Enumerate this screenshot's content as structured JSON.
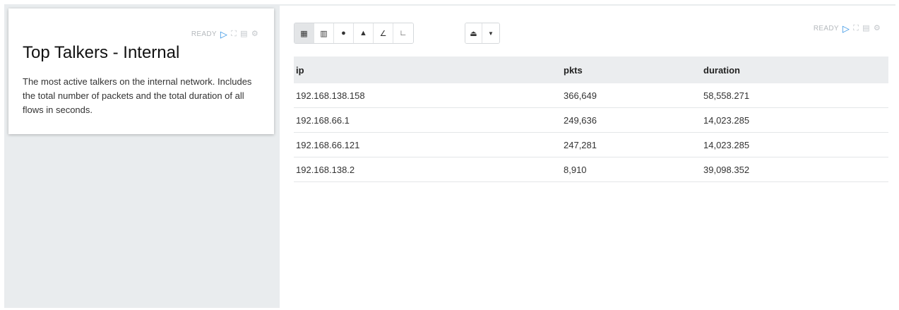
{
  "left_card": {
    "status": "READY",
    "title": "Top Talkers - Internal",
    "description": "The most active talkers on the internal network. Includes the total number of packets and the total duration of all flows in seconds."
  },
  "right_panel": {
    "status": "READY",
    "viz_buttons": [
      {
        "name": "table-view",
        "icon": "table-icon",
        "glyph": "▦"
      },
      {
        "name": "bar-chart-view",
        "icon": "bar-chart-icon",
        "glyph": "▥"
      },
      {
        "name": "pie-chart-view",
        "icon": "pie-chart-icon",
        "glyph": "●"
      },
      {
        "name": "area-chart-view",
        "icon": "area-chart-icon",
        "glyph": "▲"
      },
      {
        "name": "line-chart-view",
        "icon": "line-chart-icon",
        "glyph": "∠"
      },
      {
        "name": "scatter-chart-view",
        "icon": "scatter-chart-icon",
        "glyph": "∟"
      }
    ],
    "table": {
      "columns": [
        "ip",
        "pkts",
        "duration"
      ],
      "rows": [
        [
          "192.168.138.158",
          "366,649",
          "58,558.271"
        ],
        [
          "192.168.66.1",
          "249,636",
          "14,023.285"
        ],
        [
          "192.168.66.121",
          "247,281",
          "14,023.285"
        ],
        [
          "192.168.138.2",
          "8,910",
          "39,098.352"
        ]
      ]
    }
  },
  "colors": {
    "accent": "#2d8fe3",
    "page_background": "#e9ecee",
    "table_header": "#ebedef"
  }
}
